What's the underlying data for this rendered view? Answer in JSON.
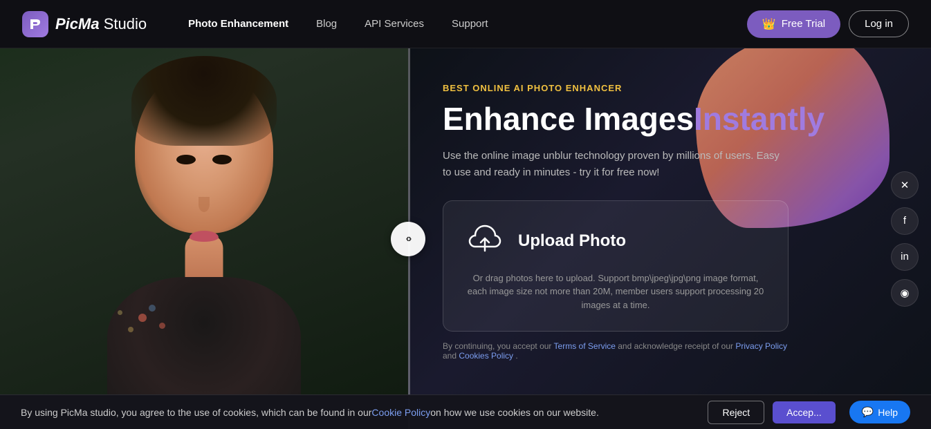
{
  "brand": {
    "logo_icon": "P",
    "name_bold": "PicMa",
    "name_light": " Studio"
  },
  "nav": {
    "links": [
      {
        "label": "Photo Enhancement",
        "active": true
      },
      {
        "label": "Blog",
        "active": false
      },
      {
        "label": "API Services",
        "active": false
      },
      {
        "label": "Support",
        "active": false
      }
    ],
    "free_trial_label": "Free Trial",
    "login_label": "Log in"
  },
  "hero": {
    "subtitle": "BEST ONLINE AI PHOTO ENHANCER",
    "title_white": "Enhance Images",
    "title_purple": "Instantly",
    "description": "Use the online image unblur technology proven by millions of users. Easy to use and ready in minutes - try it for free now!",
    "upload_title": "Upload Photo",
    "upload_desc": "Or drag photos here to upload. Support bmp\\jpeg\\jpg\\png image format, each image size not more than 20M, member users support processing 20 images at a time.",
    "terms_prefix": "By continuing, you accept our ",
    "terms_service": "Terms of Service",
    "terms_mid": " and acknowledge receipt of our ",
    "privacy_policy": "Privacy Policy",
    "and": " and ",
    "cookies_policy": "Cookies Policy",
    "period": " ."
  },
  "social": [
    {
      "label": "X / Twitter",
      "icon": "✕"
    },
    {
      "label": "Facebook",
      "icon": "f"
    },
    {
      "label": "LinkedIn",
      "icon": "in"
    },
    {
      "label": "Reddit",
      "icon": "◉"
    }
  ],
  "cookie_bar": {
    "text_prefix": "By using PicMa studio, you agree to the use of cookies, which can be found in our",
    "link_text": "Cookie Policy",
    "text_suffix": "on how we use cookies on our website.",
    "reject_label": "Reject",
    "accept_label": "Accep...",
    "help_label": "Help"
  }
}
